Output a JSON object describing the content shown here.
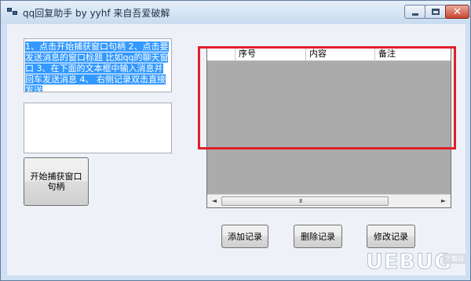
{
  "window": {
    "title": "qq回复助手 by yyhf 来自吾爱破解",
    "icons": {
      "app": "app-windows-icon",
      "minimize": "minimize-icon",
      "maximize": "maximize-icon",
      "close": "close-icon"
    },
    "close_glyph": "✕"
  },
  "info": {
    "text": "1、点击开始捕获窗口句柄 2、点击要发送消息的窗口标题 比如qq的聊天窗口 3、在下面的文本框中输入消息并回车发送消息 4、 右侧记录双击直接发送"
  },
  "input": {
    "value": ""
  },
  "buttons": {
    "capture": "开始捕获窗口句柄",
    "add": "添加记录",
    "delete": "删除记录",
    "edit": "修改记录"
  },
  "grid": {
    "columns": [
      "序号",
      "内容",
      "备注"
    ],
    "rows": [],
    "scroll": {
      "left_glyph": "◄",
      "right_glyph": "►",
      "grip": "III"
    }
  },
  "highlight_color": "#e0202b",
  "watermark": {
    "text": "UEBUG",
    "tag": "下载站"
  }
}
